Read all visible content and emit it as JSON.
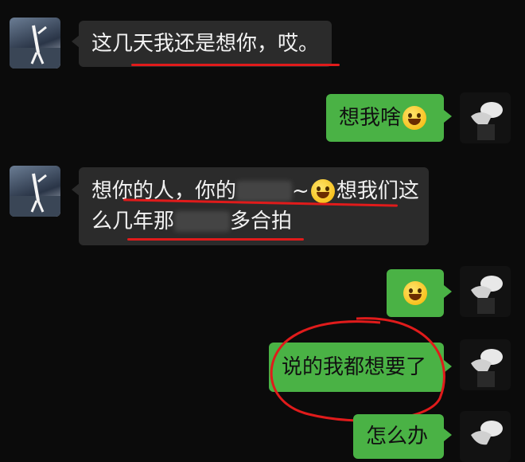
{
  "messages": [
    {
      "side": "in",
      "text": "这几天我还是想你，哎。"
    },
    {
      "side": "out",
      "text": "想我啥"
    },
    {
      "side": "in",
      "line1a": "想你的人，你的",
      "line1b": "~",
      "line1c": "想我们这",
      "line2a": "么几年那",
      "line2b": "多合拍"
    },
    {
      "side": "out",
      "text": ""
    },
    {
      "side": "out",
      "text": "说的我都想要了"
    },
    {
      "side": "out",
      "text": "怎么办"
    }
  ],
  "colors": {
    "incoming_bubble": "#2b2b2b",
    "outgoing_bubble": "#4ab245",
    "annotation": "#e01b1b",
    "background": "#0b0b0b"
  }
}
